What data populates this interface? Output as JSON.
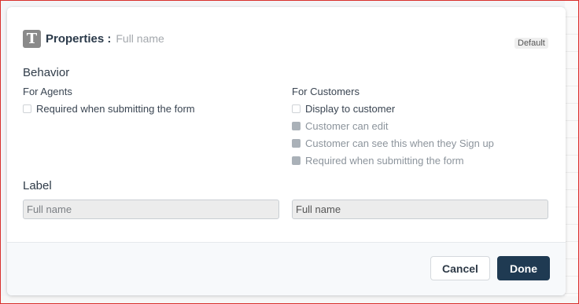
{
  "header": {
    "icon_letter": "T",
    "title": "Properties :",
    "subtitle": "Full name",
    "badge": "Default"
  },
  "behavior": {
    "title": "Behavior",
    "agents": {
      "title": "For Agents",
      "options": [
        {
          "label": "Required when submitting the form",
          "checked": false,
          "disabled": false
        }
      ]
    },
    "customers": {
      "title": "For Customers",
      "options": [
        {
          "label": "Display to customer",
          "checked": false,
          "disabled": false
        },
        {
          "label": "Customer can edit",
          "checked": false,
          "disabled": true
        },
        {
          "label": "Customer can see this when they Sign up",
          "checked": false,
          "disabled": true
        },
        {
          "label": "Required when submitting the form",
          "checked": false,
          "disabled": true
        }
      ]
    }
  },
  "label_section": {
    "title": "Label",
    "agent_label_placeholder": "Full name",
    "customer_label_value": "Full name"
  },
  "footer": {
    "cancel_label": "Cancel",
    "done_label": "Done"
  },
  "colors": {
    "primary": "#1f3a52",
    "frame": "#d9302c"
  }
}
